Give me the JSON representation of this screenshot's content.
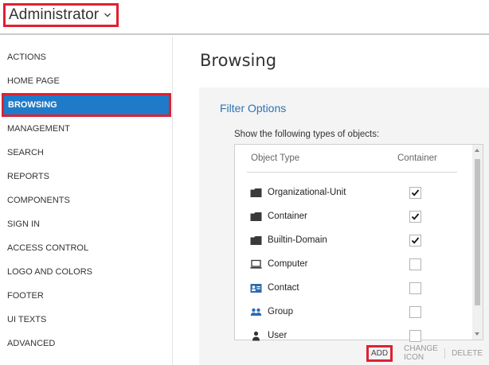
{
  "header": {
    "title": "Administrator"
  },
  "sidebar": {
    "items": [
      {
        "label": "ACTIONS"
      },
      {
        "label": "HOME PAGE"
      },
      {
        "label": "BROWSING",
        "active": true
      },
      {
        "label": "MANAGEMENT"
      },
      {
        "label": "SEARCH"
      },
      {
        "label": "REPORTS"
      },
      {
        "label": "COMPONENTS"
      },
      {
        "label": "SIGN IN"
      },
      {
        "label": "ACCESS CONTROL"
      },
      {
        "label": "LOGO AND COLORS"
      },
      {
        "label": "FOOTER"
      },
      {
        "label": "UI TEXTS"
      },
      {
        "label": "ADVANCED"
      }
    ]
  },
  "main": {
    "title": "Browsing",
    "panel": {
      "title": "Filter Options",
      "show_label": "Show the following types of objects:",
      "columns": {
        "object_type": "Object Type",
        "container": "Container"
      },
      "rows": [
        {
          "label": "Organizational-Unit",
          "icon": "folder-icon",
          "container": true
        },
        {
          "label": "Container",
          "icon": "folder-icon",
          "container": true
        },
        {
          "label": "Builtin-Domain",
          "icon": "folder-icon",
          "container": true
        },
        {
          "label": "Computer",
          "icon": "computer-icon",
          "container": false
        },
        {
          "label": "Contact",
          "icon": "contact-card-icon",
          "container": false
        },
        {
          "label": "Group",
          "icon": "group-icon",
          "container": false
        },
        {
          "label": "User",
          "icon": "user-icon",
          "container": false
        }
      ],
      "actions": {
        "add": "ADD",
        "change_icon": "CHANGE ICON",
        "delete": "DELETE"
      }
    }
  },
  "colors": {
    "accent": "#1f7ac9",
    "highlight": "#e02030",
    "link": "#2c73b5"
  }
}
